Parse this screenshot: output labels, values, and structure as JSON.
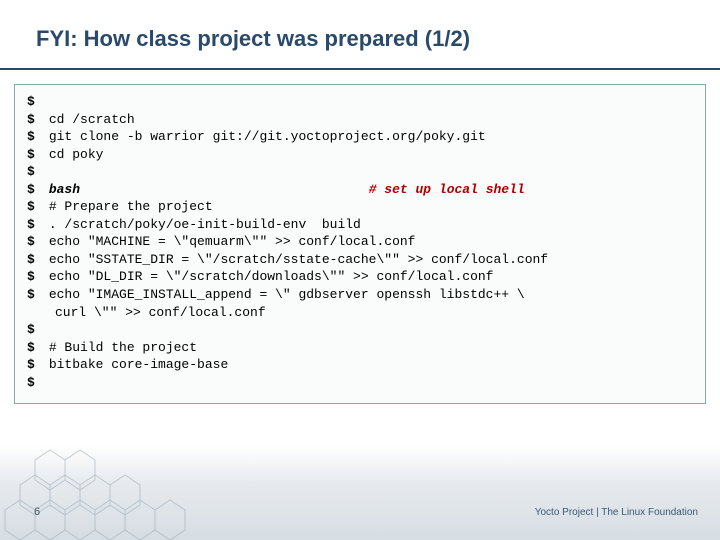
{
  "title": "FYI: How class project was prepared (1/2)",
  "lines": {
    "l0": "",
    "l1": "cd /scratch",
    "l2": "git clone -b warrior git://git.yoctoproject.org/poky.git",
    "l3": "cd poky",
    "l4": "",
    "l5_cmd": "bash",
    "l5_comment": "# set up local shell",
    "l6": "# Prepare the project",
    "l7": ". /scratch/poky/oe-init-build-env  build",
    "l8": "echo \"MACHINE = \\\"qemuarm\\\"\" >> conf/local.conf",
    "l9": "echo \"SSTATE_DIR = \\\"/scratch/sstate-cache\\\"\" >> conf/local.conf",
    "l10": "echo \"DL_DIR = \\\"/scratch/downloads\\\"\" >> conf/local.conf",
    "l11": "echo \"IMAGE_INSTALL_append = \\\" gdbserver openssh libstdc++ \\",
    "l11b": "curl \\\"\" >> conf/local.conf",
    "l12": "",
    "l13": "# Build the project",
    "l14": "bitbake core-image-base",
    "l15": ""
  },
  "page_number": "6",
  "footer": "Yocto Project | The Linux Foundation"
}
